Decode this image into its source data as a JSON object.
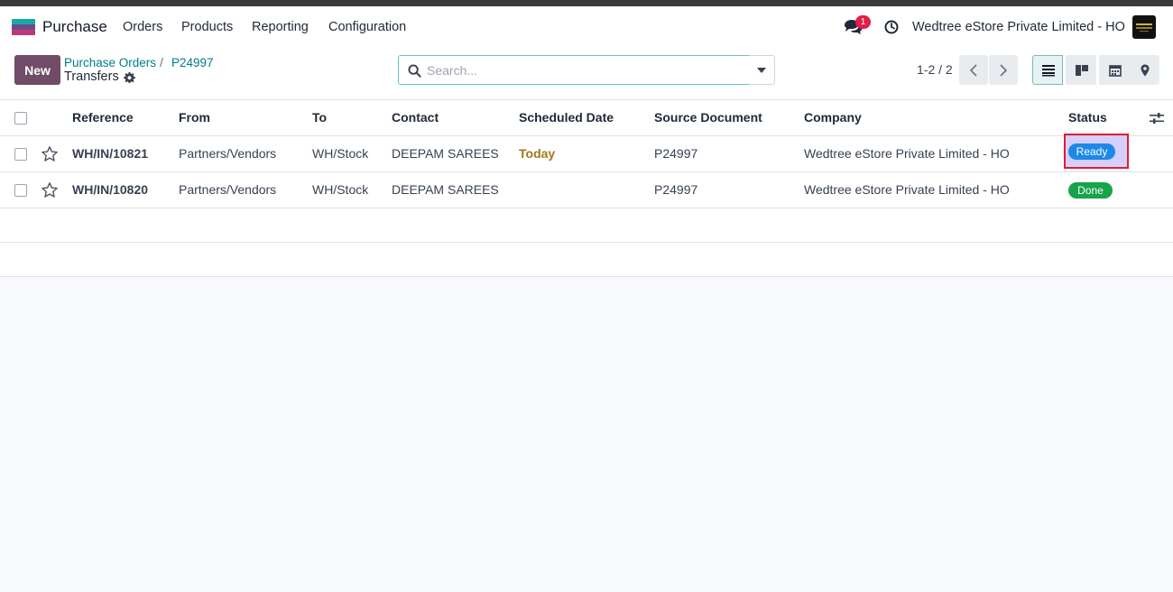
{
  "navbar": {
    "app_name": "Purchase",
    "menu": [
      "Orders",
      "Products",
      "Reporting",
      "Configuration"
    ],
    "chat_count": "1",
    "company": "Wedtree eStore Private Limited - HO",
    "accent": "#714b67"
  },
  "control": {
    "new_label": "New",
    "breadcrumb": [
      "Purchase Orders",
      "P24997"
    ],
    "breadcrumb_sep": "/",
    "current": "Transfers",
    "search_placeholder": "Search...",
    "pager": "1-2 / 2",
    "views": [
      "list-view-icon",
      "kanban-view-icon",
      "calendar-view-icon",
      "map-view-icon"
    ]
  },
  "table": {
    "columns": [
      "Reference",
      "From",
      "To",
      "Contact",
      "Scheduled Date",
      "Source Document",
      "Company",
      "Status"
    ],
    "rows": [
      {
        "reference": "WH/IN/10821",
        "from": "Partners/Vendors",
        "to": "WH/Stock",
        "contact": "DEEPAM SAREES",
        "scheduled": "Today",
        "source": "P24997",
        "company": "Wedtree eStore Private Limited - HO",
        "status": "Ready"
      },
      {
        "reference": "WH/IN/10820",
        "from": "Partners/Vendors",
        "to": "WH/Stock",
        "contact": "DEEPAM SAREES",
        "scheduled": "",
        "source": "P24997",
        "company": "Wedtree eStore Private Limited - HO",
        "status": "Done"
      }
    ],
    "status_colors": {
      "ready": "#1e88e5",
      "done": "#16a34a"
    }
  }
}
